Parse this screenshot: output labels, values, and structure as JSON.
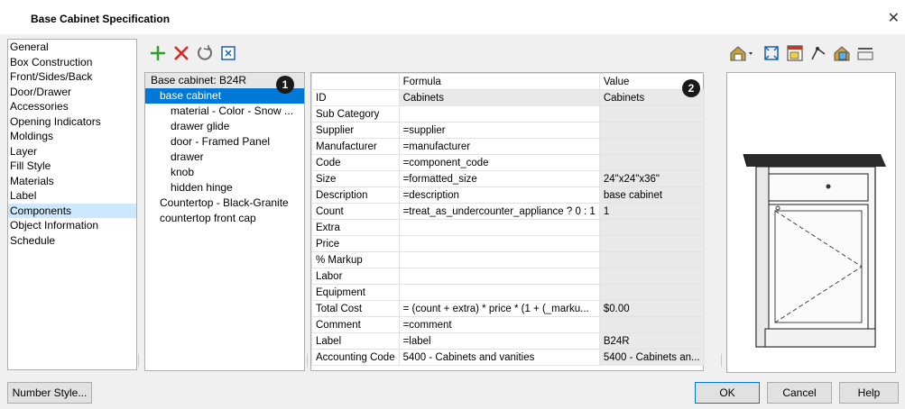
{
  "window": {
    "title": "Base Cabinet Specification",
    "close_glyph": "✕"
  },
  "nav": {
    "items": [
      {
        "label": "General"
      },
      {
        "label": "Box Construction"
      },
      {
        "label": "Front/Sides/Back"
      },
      {
        "label": "Door/Drawer"
      },
      {
        "label": "Accessories"
      },
      {
        "label": "Opening Indicators"
      },
      {
        "label": "Moldings"
      },
      {
        "label": "Layer"
      },
      {
        "label": "Fill Style"
      },
      {
        "label": "Materials"
      },
      {
        "label": "Label"
      },
      {
        "label": "Components",
        "selected": true
      },
      {
        "label": "Object Information"
      },
      {
        "label": "Schedule"
      }
    ]
  },
  "toolbar": {
    "icons": [
      "add-icon",
      "delete-icon",
      "reset-icon",
      "replace-icon"
    ],
    "colors": {
      "add": "#2e9e2e",
      "delete": "#d9261c",
      "reset": "#6b6b6b"
    }
  },
  "tree": {
    "header": "Base cabinet: B24R",
    "items": [
      {
        "label": "base cabinet",
        "indent": 1,
        "selected": true
      },
      {
        "label": "material - Color - Snow ...",
        "indent": 2
      },
      {
        "label": "drawer glide",
        "indent": 2
      },
      {
        "label": "door - Framed Panel",
        "indent": 2
      },
      {
        "label": "drawer",
        "indent": 2
      },
      {
        "label": "knob",
        "indent": 2
      },
      {
        "label": "hidden hinge",
        "indent": 2
      },
      {
        "label": "Countertop - Black-Granite",
        "indent": 1
      },
      {
        "label": "countertop front cap",
        "indent": 1
      }
    ],
    "badge": "1"
  },
  "table": {
    "headers": {
      "label": "",
      "formula": "Formula",
      "value": "Value"
    },
    "badge": "2",
    "rows": [
      {
        "label": "ID",
        "formula": "Cabinets",
        "value": "Cabinets",
        "grey_formula": true,
        "grey_value": true
      },
      {
        "label": "Sub Category",
        "formula": "",
        "value": ""
      },
      {
        "label": "Supplier",
        "formula": "=supplier",
        "value": ""
      },
      {
        "label": "Manufacturer",
        "formula": "=manufacturer",
        "value": ""
      },
      {
        "label": "Code",
        "formula": "=component_code",
        "value": ""
      },
      {
        "label": "Size",
        "formula": "=formatted_size",
        "value": "24\"x24\"x36\""
      },
      {
        "label": "Description",
        "formula": "=description",
        "value": "base cabinet"
      },
      {
        "label": "Count",
        "formula": "=treat_as_undercounter_appliance ? 0 : 1",
        "value": "1"
      },
      {
        "label": "Extra",
        "formula": "",
        "value": ""
      },
      {
        "label": "Price",
        "formula": "",
        "value": ""
      },
      {
        "label": "% Markup",
        "formula": "",
        "value": ""
      },
      {
        "label": "Labor",
        "formula": "",
        "value": ""
      },
      {
        "label": "Equipment",
        "formula": "",
        "value": ""
      },
      {
        "label": "Total Cost",
        "formula": "= (count + extra) * price * (1 + (_marku...",
        "value": "$0.00"
      },
      {
        "label": "Comment",
        "formula": "=comment",
        "value": ""
      },
      {
        "label": "Label",
        "formula": "=label",
        "value": "B24R"
      },
      {
        "label": "Accounting Code",
        "formula": "5400 - Cabinets and vanities",
        "value": "5400 - Cabinets an..."
      }
    ]
  },
  "preview_toolbar": {
    "icons": [
      "view-mode-icon",
      "fill-window-icon",
      "render-icon",
      "camera-icon",
      "camera-options-icon",
      "toggle-icon"
    ]
  },
  "buttons": {
    "number_style": "Number Style...",
    "ok": "OK",
    "cancel": "Cancel",
    "help": "Help"
  }
}
